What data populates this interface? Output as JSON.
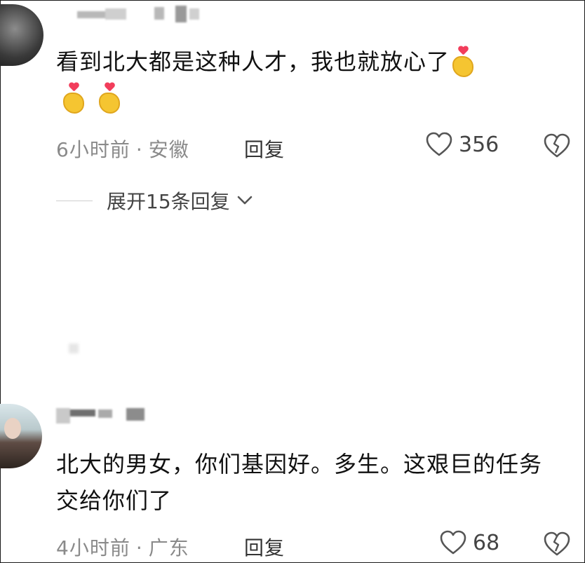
{
  "comments": [
    {
      "text": "看到北大都是这种人才，我也就放心了",
      "emoji_count": 3,
      "emoji_icon": "heart-hands-emoji",
      "time": "6小时前",
      "location": "安徽",
      "reply_label": "回复",
      "likes": "356",
      "expand_label": "展开15条回复"
    },
    {
      "text": "北大的男女，你们基因好。多生。这艰巨的任务交给你们了",
      "time": "4小时前",
      "location": "广东",
      "reply_label": "回复",
      "likes": "68"
    }
  ],
  "separator_dot": "·",
  "colors": {
    "meta": "#8a8a8a",
    "text": "#111111",
    "emoji_heart": "#f23d5b",
    "emoji_hand": "#f5c531"
  }
}
